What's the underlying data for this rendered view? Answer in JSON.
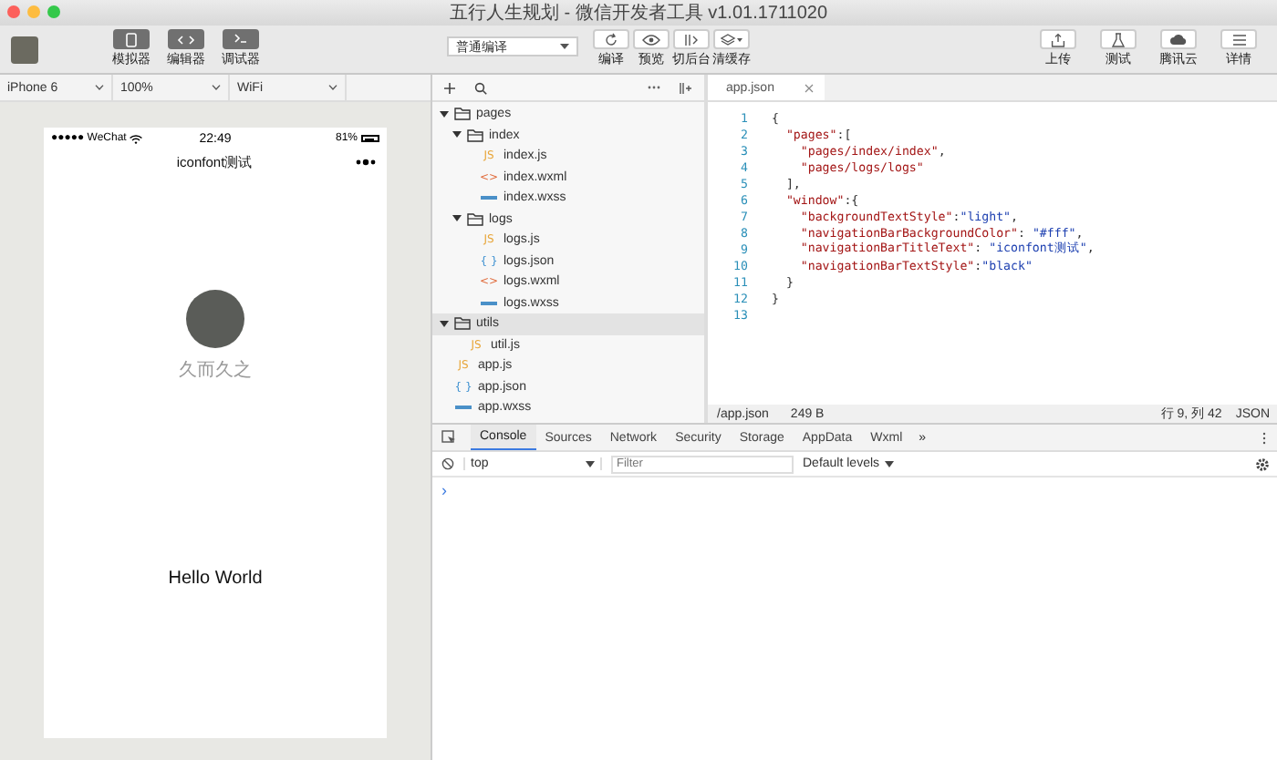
{
  "window": {
    "title": "五行人生规划 - 微信开发者工具 v1.01.1711020"
  },
  "toolbar": {
    "view_buttons": [
      {
        "label": "模拟器",
        "kind": "phone",
        "on": true
      },
      {
        "label": "编辑器",
        "kind": "code",
        "on": true
      },
      {
        "label": "调试器",
        "kind": "debug",
        "on": true
      }
    ],
    "compile_mode": {
      "value": "普通编译"
    },
    "middle_buttons": [
      {
        "label": "编译",
        "kind": "refresh"
      },
      {
        "label": "预览",
        "kind": "eye"
      },
      {
        "label": "切后台",
        "kind": "switch"
      },
      {
        "label": "清缓存",
        "kind": "stack"
      }
    ],
    "right_buttons": [
      {
        "label": "上传",
        "kind": "upload"
      },
      {
        "label": "测试",
        "kind": "flask"
      },
      {
        "label": "腾讯云",
        "kind": "cloud"
      },
      {
        "label": "详情",
        "kind": "menu"
      }
    ]
  },
  "device_bar": {
    "device": "iPhone 6",
    "zoom": "100%",
    "network": "WiFi"
  },
  "phone": {
    "carrier": "●●●●● WeChat",
    "time": "22:49",
    "battery": "81%",
    "nav_title": "iconfont测试",
    "nickname": "久而久之",
    "greeting": "Hello World"
  },
  "file_tree": [
    {
      "name": "pages",
      "kind": "folder",
      "expanded": true,
      "selected": false,
      "children": [
        {
          "name": "index",
          "kind": "folder",
          "expanded": true,
          "selected": false,
          "children": [
            {
              "name": "index.js",
              "kind": "js",
              "icon": "JS",
              "selected": false
            },
            {
              "name": "index.wxml",
              "kind": "wxml",
              "icon": "<>",
              "selected": false
            },
            {
              "name": "index.wxss",
              "kind": "wxss",
              "selected": false
            }
          ]
        },
        {
          "name": "logs",
          "kind": "folder",
          "expanded": true,
          "selected": false,
          "children": [
            {
              "name": "logs.js",
              "kind": "js",
              "icon": "JS",
              "selected": false
            },
            {
              "name": "logs.json",
              "kind": "json",
              "icon": "{ }",
              "selected": false
            },
            {
              "name": "logs.wxml",
              "kind": "wxml",
              "icon": "<>",
              "selected": false
            },
            {
              "name": "logs.wxss",
              "kind": "wxss",
              "selected": false
            }
          ]
        }
      ]
    },
    {
      "name": "utils",
      "kind": "folder",
      "expanded": true,
      "selected": true,
      "children": [
        {
          "name": "util.js",
          "kind": "js",
          "icon": "JS",
          "selected": false
        }
      ]
    },
    {
      "name": "app.js",
      "kind": "js",
      "icon": "JS",
      "selected": false
    },
    {
      "name": "app.json",
      "kind": "json",
      "icon": "{ }",
      "selected": false
    },
    {
      "name": "app.wxss",
      "kind": "wxss",
      "selected": false
    }
  ],
  "editor": {
    "tabs": [
      {
        "label": "app.json",
        "selected": true
      }
    ],
    "lines": [
      {
        "number": "1",
        "tokens": [
          {
            "kind": "punct",
            "text": "{"
          }
        ]
      },
      {
        "number": "2",
        "tokens": [
          {
            "kind": "key",
            "text": "  \"pages\""
          },
          {
            "kind": "punct",
            "text": ":["
          }
        ]
      },
      {
        "number": "3",
        "tokens": [
          {
            "kind": "key",
            "text": "    \"pages/index/index\""
          },
          {
            "kind": "punct",
            "text": ","
          }
        ]
      },
      {
        "number": "4",
        "tokens": [
          {
            "kind": "key",
            "text": "    \"pages/logs/logs\""
          }
        ]
      },
      {
        "number": "5",
        "tokens": [
          {
            "kind": "punct",
            "text": "  ],"
          }
        ]
      },
      {
        "number": "6",
        "tokens": [
          {
            "kind": "key",
            "text": "  \"window\""
          },
          {
            "kind": "punct",
            "text": ":{"
          }
        ]
      },
      {
        "number": "7",
        "tokens": [
          {
            "kind": "key",
            "text": "    \"backgroundTextStyle\""
          },
          {
            "kind": "punct",
            "text": ":"
          },
          {
            "kind": "value",
            "text": "\"light\""
          },
          {
            "kind": "punct",
            "text": ","
          }
        ]
      },
      {
        "number": "8",
        "tokens": [
          {
            "kind": "key",
            "text": "    \"navigationBarBackgroundColor\""
          },
          {
            "kind": "punct",
            "text": ": "
          },
          {
            "kind": "value",
            "text": "\"#fff\""
          },
          {
            "kind": "punct",
            "text": ","
          }
        ]
      },
      {
        "number": "9",
        "tokens": [
          {
            "kind": "key",
            "text": "    \"navigationBarTitleText\""
          },
          {
            "kind": "punct",
            "text": ": "
          },
          {
            "kind": "value",
            "text": "\"iconfont测试\""
          },
          {
            "kind": "punct",
            "text": ","
          }
        ]
      },
      {
        "number": "10",
        "tokens": [
          {
            "kind": "key",
            "text": "    \"navigationBarTextStyle\""
          },
          {
            "kind": "punct",
            "text": ":"
          },
          {
            "kind": "value",
            "text": "\"black\""
          }
        ]
      },
      {
        "number": "11",
        "tokens": [
          {
            "kind": "punct",
            "text": "  }"
          }
        ]
      },
      {
        "number": "12",
        "tokens": [
          {
            "kind": "punct",
            "text": "}"
          }
        ]
      },
      {
        "number": "13"
      }
    ],
    "status": {
      "path": "/app.json",
      "size": "249 B",
      "cursor": "行 9, 列 42",
      "language": "JSON"
    }
  },
  "devtools": {
    "tabs": [
      {
        "label": "Console",
        "selected": true
      },
      {
        "label": "Sources",
        "selected": false
      },
      {
        "label": "Network",
        "selected": false
      },
      {
        "label": "Security",
        "selected": false
      },
      {
        "label": "Storage",
        "selected": false
      },
      {
        "label": "AppData",
        "selected": false
      },
      {
        "label": "Wxml",
        "selected": false
      }
    ],
    "more": "»",
    "context": "top",
    "filter_placeholder": "Filter",
    "levels": "Default levels",
    "prompt": "›"
  }
}
